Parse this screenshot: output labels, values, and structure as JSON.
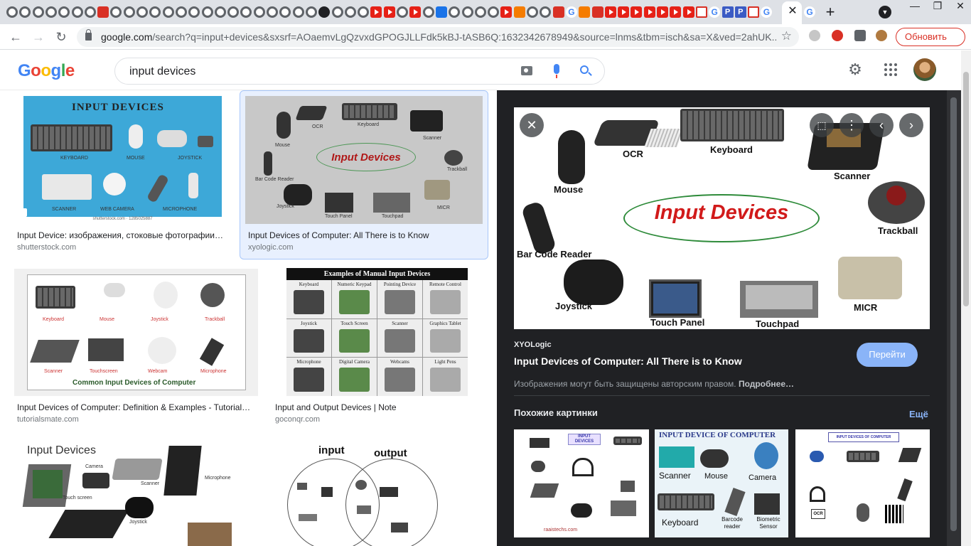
{
  "browser": {
    "tab_close": "✕",
    "new_tab": "+",
    "url_host": "google.com",
    "url_rest": "/search?q=input+devices&sxsrf=AOaemvLgQzvxdGPOGJLLFdk5kBJ-tASB6Q:1632342678949&source=lnms&tbm=isch&sa=X&ved=2ahUK...",
    "update_label": "Обновить",
    "window_min": "—",
    "window_max": "❐",
    "window_close": "✕",
    "favicon_letters": {
      "g": "G",
      "p": "P"
    }
  },
  "search": {
    "query": "input devices",
    "logo": [
      "G",
      "o",
      "o",
      "g",
      "l",
      "e"
    ]
  },
  "results": [
    {
      "title": "Input Device: изображения, стоковые фотографии…",
      "source": "shutterstock.com",
      "heading": "INPUT DEVICES",
      "labels": [
        "KEYBOARD",
        "MOUSE",
        "JOYSTICK",
        "SCANNER",
        "WEB CAMERA",
        "MICROPHONE",
        "shutterstock.com · 1285025887"
      ]
    },
    {
      "title": "Input Devices of Computer: All There is to Know",
      "source": "xyologic.com"
    },
    {
      "title": "Input Devices of Computer: Definition & Examples - Tutorial…",
      "source": "tutorialsmate.com",
      "labels": [
        "Keyboard",
        "Mouse",
        "Joystick",
        "Trackball",
        "Scanner",
        "Touchscreen",
        "Webcam",
        "Microphone",
        "Common Input Devices of Computer"
      ]
    },
    {
      "title": "Input and Output Devices | Note",
      "source": "goconqr.com",
      "heading": "Examples of Manual Input Devices",
      "labels": [
        "Keyboard",
        "Numeric Keypad",
        "Pointing Device",
        "Remote Control",
        "Joystick",
        "Touch Screen",
        "Scanner",
        "Graphics Tablet",
        "Microphone",
        "Digital Camera",
        "Webcams",
        "Light Pens"
      ]
    },
    {
      "heading": "Input Devices",
      "labels": [
        "Camera",
        "Scanner",
        "Microphone",
        "Touch screen",
        "Joystick"
      ]
    },
    {
      "heading_left": "input",
      "heading_right": "output"
    }
  ],
  "panel": {
    "source": "XYOLogic",
    "title": "Input Devices of Computer: All There is to Know",
    "visit_label": "Перейти",
    "copyright": "Изображения могут быть защищены авторским правом.",
    "copyright_more": "Подробнее…",
    "similar_heading": "Похожие картинки",
    "more_label": "Ещё",
    "preview_title": "Input Devices",
    "preview_labels": [
      "Mouse",
      "OCR",
      "Keyboard",
      "Scanner",
      "Trackball",
      "Bar Code Reader",
      "Joystick",
      "Touch Panel",
      "Touchpad",
      "MICR"
    ],
    "similar": [
      {
        "heading": "INPUT DEVICES",
        "footer": "raaistechs.com"
      },
      {
        "heading": "INPUT DEVICE OF COMPUTER",
        "labels": [
          "Scanner",
          "Mouse",
          "Camera",
          "Keyboard",
          "Barcode reader",
          "Biometric Sensor"
        ]
      },
      {
        "heading": "INPUT DEVICES OF COMPUTER",
        "labels": [
          "OCR"
        ]
      }
    ]
  }
}
